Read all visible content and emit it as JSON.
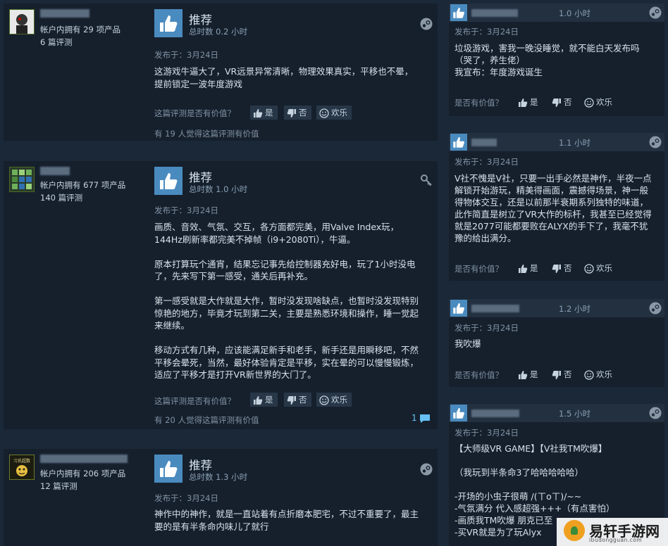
{
  "reviews": [
    {
      "owned": "帐户内拥有 29 项产品",
      "count": "6 篇评测",
      "title": "推荐",
      "hours": "总时数 0.2 小时",
      "posted": "发布于：3月24日",
      "text": "这游戏牛逼大了，VR远景异常清晰，物理效果真实，平移也不晕，\n提前锁定一波年度游戏",
      "helpful_q": "这篇评测是否有价值？",
      "yes": "是",
      "no": "否",
      "funny": "欢乐",
      "helpful": "有 19 人觉得这篇评测有价值"
    },
    {
      "owned": "帐户内拥有 677 项产品",
      "count": "140 篇评测",
      "title": "推荐",
      "hours": "总时数 1.0 小时",
      "posted": "发布于：3月24日",
      "text": "画质、音效、气氛、交互，各方面都完美，用Valve Index玩，\n144Hz刷新率都完美不掉帧（i9+2080Ti），牛逼。\n\n原本打算玩个通宵，结果忘记事先给控制器充好电，玩了1小时没电\n了，先来写下第一感受，通关后再补充。\n\n第一感受就是大作就是大作，暂时没发现啥缺点，也暂时没发现特别\n惊艳的地方，毕竟才玩到第二关，主要是熟悉环境和操作，睡一觉起\n来继续。\n\n移动方式有几种，应该能满足新手和老手，新手还是用瞬移吧，不然\n平移会晕死，当然，最好体验肯定是平移，实在晕的可以慢慢锻炼，\n适应了平移才是打开VR新世界的大门了。",
      "helpful_q": "这篇评测是否有价值？",
      "yes": "是",
      "no": "否",
      "funny": "欢乐",
      "helpful": "有 20 人觉得这篇评测有价值",
      "comments": "1"
    },
    {
      "owned": "帐户内拥有 206 项产品",
      "count": "12 篇评测",
      "avatar_text": "习氏超数",
      "title": "推荐",
      "hours": "总时数 1.3 小时",
      "posted": "发布于：3月24日",
      "text": "神作中的神作，就是一直站着有点折磨本肥宅，不过不重要了，最主\n要的是有半条命内味儿了就行"
    }
  ],
  "side": [
    {
      "hours": "1.0 小时",
      "posted": "发布于：3月24日",
      "text": "垃圾游戏，害我一晚没睡觉，就不能白天发布吗\n（哭了，养生佬）\n我宣布：年度游戏诞生",
      "helpful_q": "是否有价值？",
      "yes": "是",
      "no": "否",
      "funny": "欢乐"
    },
    {
      "hours": "1.1 小时",
      "posted": "发布于：3月24日",
      "text": "V社不愧是V社，只要一出手必然是神作，半夜一点\n解锁开始游玩，精美得画面，震撼得场景，神一般\n得物体交互，还是以前那半衰期系列独特的味道，\n此作简直是树立了VR大作的标杆，我甚至已经觉得\n就是2077可能都要败在ALYX的手下了，我毫不犹\n豫的给出满分。",
      "helpful_q": "是否有价值？",
      "yes": "是",
      "no": "否",
      "funny": "欢乐"
    },
    {
      "hours": "1.2 小时",
      "posted": "发布于：3月24日",
      "text": "我吹爆",
      "helpful_q": "是否有价值？",
      "yes": "是",
      "no": "否",
      "funny": "欢乐"
    },
    {
      "hours": "1.5 小时",
      "posted": "发布于：3月24日",
      "text": "【大师级VR GAME】【V社我TM吹爆】\n\n（我玩到半条命3了哈哈哈哈哈）\n\n-开场的小虫子很萌 /(ㄒoㄒ)/~~\n-气氛满分 代入感超强+++（有点害怕）\n-画质我TM吹爆 朋克已至\n-买VR就是为了玩Alyx"
    }
  ],
  "watermark": {
    "title": "易轩手游网",
    "sub": "ibudongguan.com"
  }
}
